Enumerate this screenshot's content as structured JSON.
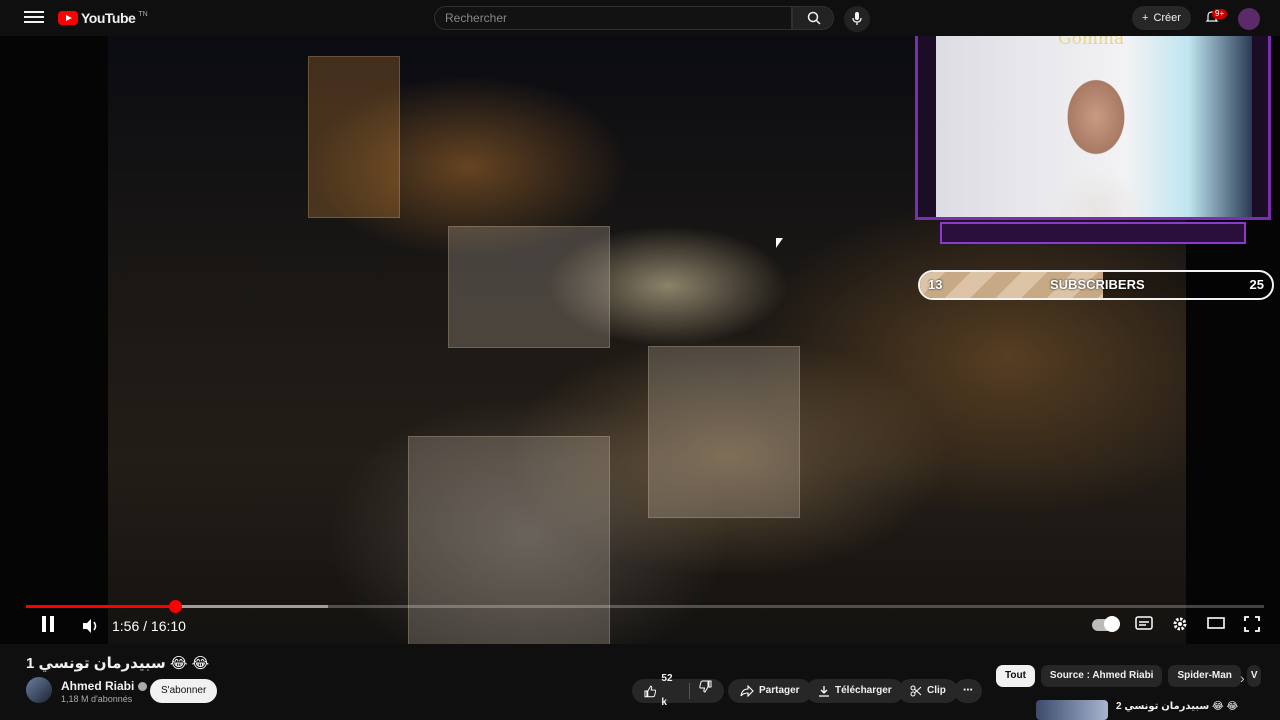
{
  "header": {
    "logo_text": "YouTube",
    "logo_superscript": "TN",
    "search_placeholder": "Rechercher",
    "create_label": "Créer",
    "notifications_badge": "9+"
  },
  "player": {
    "overlay_name": "Gomma",
    "subscriber_goal": {
      "current": "13",
      "label": "SUBSCRIBERS",
      "target": "25",
      "fill_fraction": 0.52
    },
    "time_current": "1:56",
    "time_separator": "/",
    "time_total": "16:10",
    "played_fraction": 0.12,
    "buffered_fraction": 0.244
  },
  "video": {
    "title": "1 سبيدرمان تونسي 😂 😂",
    "channel_name": "Ahmed Riabi",
    "channel_subscribers": "1,18 M d'abonnés",
    "subscribe_label": "S'abonner",
    "likes": "52 k",
    "share_label": "Partager",
    "download_label": "Télécharger",
    "clip_label": "Clip",
    "more_label": "⋯"
  },
  "sidebar": {
    "chips": [
      "Tout",
      "Source : Ahmed Riabi",
      "Spider-Man",
      "V"
    ],
    "first_video_title": "سبيدرمان تونسي 2 😂 😂"
  },
  "colors": {
    "accent": "#ff0000",
    "overlay_purple": "#7b2fb0"
  }
}
